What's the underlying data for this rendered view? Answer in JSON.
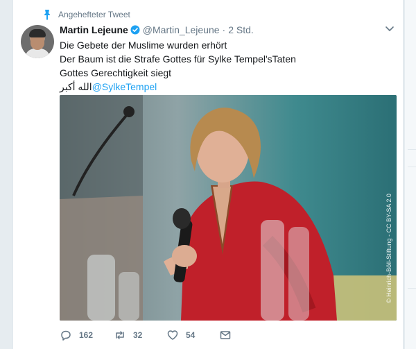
{
  "pinned": {
    "label": "Angehefteter Tweet",
    "icon": "pin-icon"
  },
  "author": {
    "name": "Martin Lejeune",
    "handle": "@Martin_Lejeune",
    "verified": true
  },
  "tweet": {
    "time_separator": "·",
    "time": "2 Std.",
    "lines": [
      "Die Gebete der Muslime wurden erhört",
      "Der Baum ist die Strafe Gottes für Sylke Tempel'sTaten",
      "Gottes Gerechtigkeit siegt"
    ],
    "arabic": "الله أكبر",
    "mention": "@SylkeTempel"
  },
  "photo": {
    "watermark": "© Heinrich-Böll-Stiftung - CC BY-SA 2.0"
  },
  "actions": {
    "reply_count": "162",
    "retweet_count": "32",
    "like_count": "54"
  },
  "colors": {
    "accent": "#1da1f2",
    "muted": "#657786",
    "text": "#14171a",
    "background": "#e6ecf0"
  }
}
